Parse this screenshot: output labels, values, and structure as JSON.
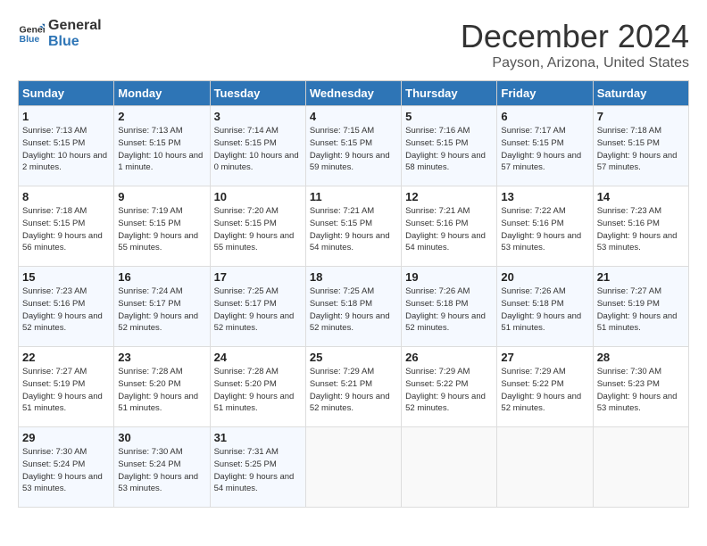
{
  "header": {
    "logo_line1": "General",
    "logo_line2": "Blue",
    "month": "December 2024",
    "location": "Payson, Arizona, United States"
  },
  "weekdays": [
    "Sunday",
    "Monday",
    "Tuesday",
    "Wednesday",
    "Thursday",
    "Friday",
    "Saturday"
  ],
  "weeks": [
    [
      {
        "day": "1",
        "sunrise": "Sunrise: 7:13 AM",
        "sunset": "Sunset: 5:15 PM",
        "daylight": "Daylight: 10 hours and 2 minutes."
      },
      {
        "day": "2",
        "sunrise": "Sunrise: 7:13 AM",
        "sunset": "Sunset: 5:15 PM",
        "daylight": "Daylight: 10 hours and 1 minute."
      },
      {
        "day": "3",
        "sunrise": "Sunrise: 7:14 AM",
        "sunset": "Sunset: 5:15 PM",
        "daylight": "Daylight: 10 hours and 0 minutes."
      },
      {
        "day": "4",
        "sunrise": "Sunrise: 7:15 AM",
        "sunset": "Sunset: 5:15 PM",
        "daylight": "Daylight: 9 hours and 59 minutes."
      },
      {
        "day": "5",
        "sunrise": "Sunrise: 7:16 AM",
        "sunset": "Sunset: 5:15 PM",
        "daylight": "Daylight: 9 hours and 58 minutes."
      },
      {
        "day": "6",
        "sunrise": "Sunrise: 7:17 AM",
        "sunset": "Sunset: 5:15 PM",
        "daylight": "Daylight: 9 hours and 57 minutes."
      },
      {
        "day": "7",
        "sunrise": "Sunrise: 7:18 AM",
        "sunset": "Sunset: 5:15 PM",
        "daylight": "Daylight: 9 hours and 57 minutes."
      }
    ],
    [
      {
        "day": "8",
        "sunrise": "Sunrise: 7:18 AM",
        "sunset": "Sunset: 5:15 PM",
        "daylight": "Daylight: 9 hours and 56 minutes."
      },
      {
        "day": "9",
        "sunrise": "Sunrise: 7:19 AM",
        "sunset": "Sunset: 5:15 PM",
        "daylight": "Daylight: 9 hours and 55 minutes."
      },
      {
        "day": "10",
        "sunrise": "Sunrise: 7:20 AM",
        "sunset": "Sunset: 5:15 PM",
        "daylight": "Daylight: 9 hours and 55 minutes."
      },
      {
        "day": "11",
        "sunrise": "Sunrise: 7:21 AM",
        "sunset": "Sunset: 5:15 PM",
        "daylight": "Daylight: 9 hours and 54 minutes."
      },
      {
        "day": "12",
        "sunrise": "Sunrise: 7:21 AM",
        "sunset": "Sunset: 5:16 PM",
        "daylight": "Daylight: 9 hours and 54 minutes."
      },
      {
        "day": "13",
        "sunrise": "Sunrise: 7:22 AM",
        "sunset": "Sunset: 5:16 PM",
        "daylight": "Daylight: 9 hours and 53 minutes."
      },
      {
        "day": "14",
        "sunrise": "Sunrise: 7:23 AM",
        "sunset": "Sunset: 5:16 PM",
        "daylight": "Daylight: 9 hours and 53 minutes."
      }
    ],
    [
      {
        "day": "15",
        "sunrise": "Sunrise: 7:23 AM",
        "sunset": "Sunset: 5:16 PM",
        "daylight": "Daylight: 9 hours and 52 minutes."
      },
      {
        "day": "16",
        "sunrise": "Sunrise: 7:24 AM",
        "sunset": "Sunset: 5:17 PM",
        "daylight": "Daylight: 9 hours and 52 minutes."
      },
      {
        "day": "17",
        "sunrise": "Sunrise: 7:25 AM",
        "sunset": "Sunset: 5:17 PM",
        "daylight": "Daylight: 9 hours and 52 minutes."
      },
      {
        "day": "18",
        "sunrise": "Sunrise: 7:25 AM",
        "sunset": "Sunset: 5:18 PM",
        "daylight": "Daylight: 9 hours and 52 minutes."
      },
      {
        "day": "19",
        "sunrise": "Sunrise: 7:26 AM",
        "sunset": "Sunset: 5:18 PM",
        "daylight": "Daylight: 9 hours and 52 minutes."
      },
      {
        "day": "20",
        "sunrise": "Sunrise: 7:26 AM",
        "sunset": "Sunset: 5:18 PM",
        "daylight": "Daylight: 9 hours and 51 minutes."
      },
      {
        "day": "21",
        "sunrise": "Sunrise: 7:27 AM",
        "sunset": "Sunset: 5:19 PM",
        "daylight": "Daylight: 9 hours and 51 minutes."
      }
    ],
    [
      {
        "day": "22",
        "sunrise": "Sunrise: 7:27 AM",
        "sunset": "Sunset: 5:19 PM",
        "daylight": "Daylight: 9 hours and 51 minutes."
      },
      {
        "day": "23",
        "sunrise": "Sunrise: 7:28 AM",
        "sunset": "Sunset: 5:20 PM",
        "daylight": "Daylight: 9 hours and 51 minutes."
      },
      {
        "day": "24",
        "sunrise": "Sunrise: 7:28 AM",
        "sunset": "Sunset: 5:20 PM",
        "daylight": "Daylight: 9 hours and 51 minutes."
      },
      {
        "day": "25",
        "sunrise": "Sunrise: 7:29 AM",
        "sunset": "Sunset: 5:21 PM",
        "daylight": "Daylight: 9 hours and 52 minutes."
      },
      {
        "day": "26",
        "sunrise": "Sunrise: 7:29 AM",
        "sunset": "Sunset: 5:22 PM",
        "daylight": "Daylight: 9 hours and 52 minutes."
      },
      {
        "day": "27",
        "sunrise": "Sunrise: 7:29 AM",
        "sunset": "Sunset: 5:22 PM",
        "daylight": "Daylight: 9 hours and 52 minutes."
      },
      {
        "day": "28",
        "sunrise": "Sunrise: 7:30 AM",
        "sunset": "Sunset: 5:23 PM",
        "daylight": "Daylight: 9 hours and 53 minutes."
      }
    ],
    [
      {
        "day": "29",
        "sunrise": "Sunrise: 7:30 AM",
        "sunset": "Sunset: 5:24 PM",
        "daylight": "Daylight: 9 hours and 53 minutes."
      },
      {
        "day": "30",
        "sunrise": "Sunrise: 7:30 AM",
        "sunset": "Sunset: 5:24 PM",
        "daylight": "Daylight: 9 hours and 53 minutes."
      },
      {
        "day": "31",
        "sunrise": "Sunrise: 7:31 AM",
        "sunset": "Sunset: 5:25 PM",
        "daylight": "Daylight: 9 hours and 54 minutes."
      },
      null,
      null,
      null,
      null
    ]
  ]
}
